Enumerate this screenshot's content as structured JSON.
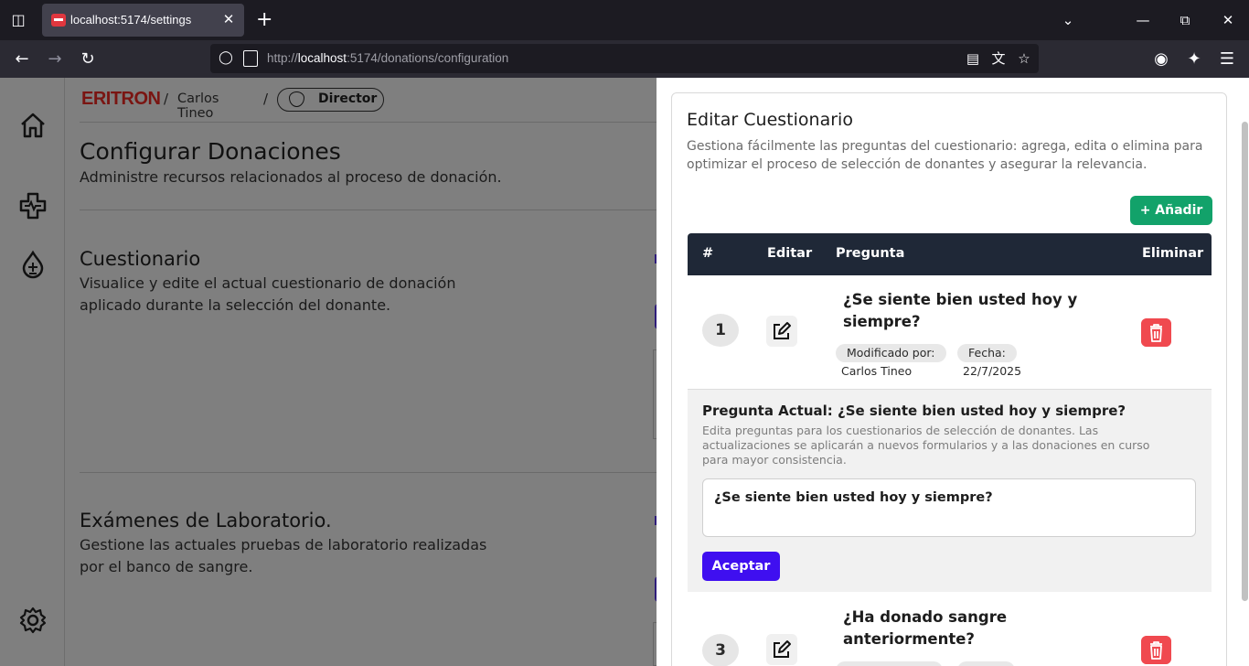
{
  "browser": {
    "tab_title": "localhost:5174/settings",
    "url_scheme": "http://",
    "url_host": "localhost",
    "url_rest": ":5174/donations/configuration"
  },
  "breadcrumb": {
    "logo": "ERITRON",
    "user": "Carlos Tineo",
    "role": "Director"
  },
  "page": {
    "title": "Configurar Donaciones",
    "subtitle": "Administre recursos relacionados al proceso de donación.",
    "sections": [
      {
        "title": "Cuestionario",
        "desc_line1": "Visualice y edite el actual cuestionario de donación",
        "desc_line2": "aplicado durante la selección del donante."
      },
      {
        "title": "Exámenes de Laboratorio.",
        "desc_line1": "Gestione las actuales pruebas de laboratorio realizadas",
        "desc_line2": "por el banco de sangre."
      }
    ]
  },
  "panel": {
    "title": "Editar Cuestionario",
    "description": "Gestiona fácilmente las preguntas del cuestionario: agrega, edita o elimina para optimizar el proceso de selección de donantes y asegurar la relevancia.",
    "add_label": "+ Añadir",
    "columns": [
      "#",
      "Editar",
      "Pregunta",
      "Eliminar"
    ],
    "rows": [
      {
        "num": "1",
        "question": "¿Se siente bien usted hoy y siempre?",
        "modified_label": "Modificado por:",
        "modified_by": "Carlos Tineo",
        "date_label": "Fecha:",
        "date": "22/7/2025"
      },
      {
        "num": "3",
        "question": "¿Ha donado sangre anteriormente?"
      }
    ],
    "editor": {
      "title": "Pregunta Actual: ¿Se siente bien usted hoy y siempre?",
      "description": "Edita preguntas para los cuestionarios de selección de donantes. Las actualizaciones se aplicarán a nuevos formularios y a las donaciones en curso para mayor consistencia.",
      "value": "¿Se siente bien usted hoy y siempre?",
      "accept_label": "Aceptar"
    }
  },
  "colors": {
    "add": "#12a26a",
    "header": "#1f2837",
    "delete": "#f0494f",
    "accept": "#3f0ff0"
  }
}
